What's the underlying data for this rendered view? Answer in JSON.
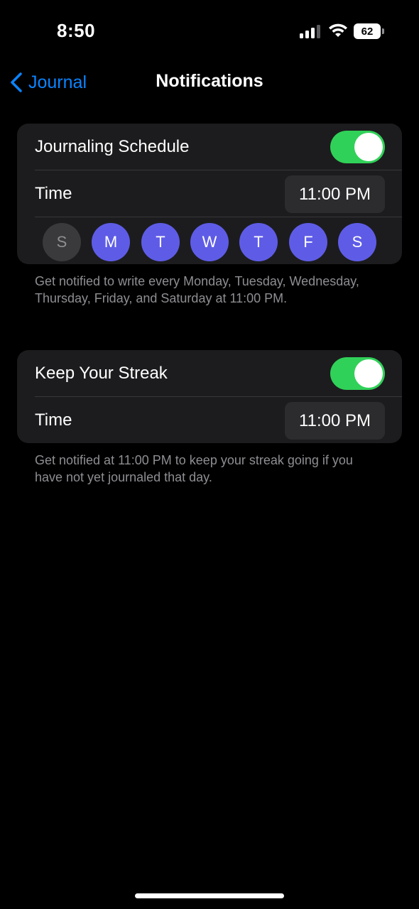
{
  "status_bar": {
    "time": "8:50",
    "battery_level": "62",
    "icons": [
      "signal-icon",
      "wifi-icon",
      "battery-icon"
    ]
  },
  "nav": {
    "back_label": "Journal",
    "title": "Notifications"
  },
  "schedule": {
    "label": "Journaling Schedule",
    "enabled": true,
    "time_label": "Time",
    "time_value": "11:00 PM",
    "days": [
      {
        "letter": "S",
        "selected": false
      },
      {
        "letter": "M",
        "selected": true
      },
      {
        "letter": "T",
        "selected": true
      },
      {
        "letter": "W",
        "selected": true
      },
      {
        "letter": "T",
        "selected": true
      },
      {
        "letter": "F",
        "selected": true
      },
      {
        "letter": "S",
        "selected": true
      }
    ],
    "footnote": "Get notified to write every Monday, Tuesday, Wednesday, Thursday, Friday, and Saturday at 11:00 PM."
  },
  "streak": {
    "label": "Keep Your Streak",
    "enabled": true,
    "time_label": "Time",
    "time_value": "11:00 PM",
    "footnote": "Get notified at 11:00 PM to keep your streak going if you have not yet journaled that day."
  },
  "colors": {
    "accent_blue": "#0a84ff",
    "toggle_green": "#30d158",
    "day_selected": "#5e5ce6",
    "day_unselected": "#3a3a3c",
    "group_bg": "#1c1c1e"
  }
}
